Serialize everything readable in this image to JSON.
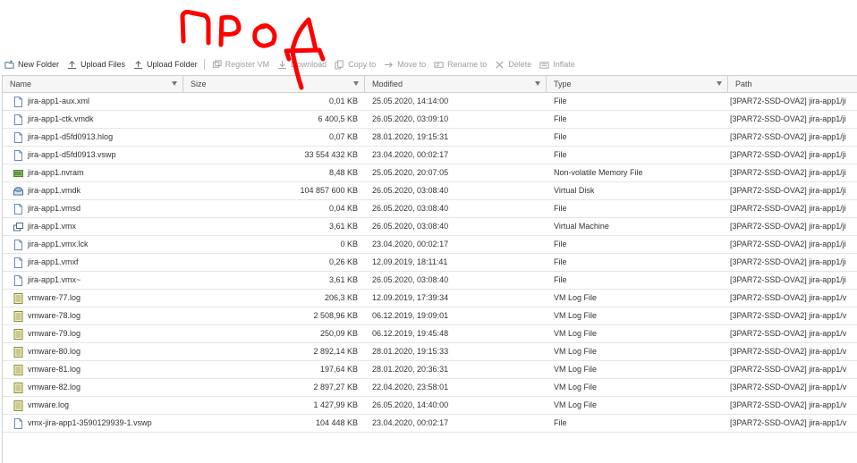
{
  "annotation_text": "ПРОД",
  "toolbar": [
    {
      "label": "New Folder",
      "icon": "new-folder-icon",
      "enabled": true
    },
    {
      "label": "Upload Files",
      "icon": "upload-icon",
      "enabled": true
    },
    {
      "label": "Upload Folder",
      "icon": "upload-icon",
      "enabled": true
    },
    {
      "label": "Register VM",
      "icon": "register-vm-icon",
      "enabled": false
    },
    {
      "label": "Download",
      "icon": "download-icon",
      "enabled": false
    },
    {
      "label": "Copy to",
      "icon": "copy-icon",
      "enabled": false
    },
    {
      "label": "Move to",
      "icon": "move-icon",
      "enabled": false
    },
    {
      "label": "Rename to",
      "icon": "rename-icon",
      "enabled": false
    },
    {
      "label": "Delete",
      "icon": "delete-icon",
      "enabled": false
    },
    {
      "label": "Inflate",
      "icon": "inflate-icon",
      "enabled": false
    }
  ],
  "columns": [
    "Name",
    "Size",
    "Modified",
    "Type",
    "Path"
  ],
  "rows": [
    {
      "name": "jira-app1-aux.xml",
      "size": "0,01 KB",
      "modified": "25.05.2020, 14:14:00",
      "type": "File",
      "path": "[3PAR72-SSD-OVA2] jira-app1/ji",
      "icon": "file-icon"
    },
    {
      "name": "jira-app1-ctk.vmdk",
      "size": "6 400,5 KB",
      "modified": "26.05.2020, 03:09:10",
      "type": "File",
      "path": "[3PAR72-SSD-OVA2] jira-app1/ji",
      "icon": "file-icon"
    },
    {
      "name": "jira-app1-d5fd0913.hlog",
      "size": "0,07 KB",
      "modified": "28.01.2020, 19:15:31",
      "type": "File",
      "path": "[3PAR72-SSD-OVA2] jira-app1/ji",
      "icon": "file-icon"
    },
    {
      "name": "jira-app1-d5fd0913.vswp",
      "size": "33 554 432 KB",
      "modified": "23.04.2020, 00:02:17",
      "type": "File",
      "path": "[3PAR72-SSD-OVA2] jira-app1/ji",
      "icon": "file-icon"
    },
    {
      "name": "jira-app1.nvram",
      "size": "8,48 KB",
      "modified": "25.05.2020, 20:07:05",
      "type": "Non-volatile Memory File",
      "path": "[3PAR72-SSD-OVA2] jira-app1/ji",
      "icon": "nvram-icon"
    },
    {
      "name": "jira-app1.vmdk",
      "size": "104 857 600 KB",
      "modified": "26.05.2020, 03:08:40",
      "type": "Virtual Disk",
      "path": "[3PAR72-SSD-OVA2] jira-app1/ji",
      "icon": "virtual-disk-icon"
    },
    {
      "name": "jira-app1.vmsd",
      "size": "0,04 KB",
      "modified": "26.05.2020, 03:08:40",
      "type": "File",
      "path": "[3PAR72-SSD-OVA2] jira-app1/ji",
      "icon": "file-icon"
    },
    {
      "name": "jira-app1.vmx",
      "size": "3,61 KB",
      "modified": "26.05.2020, 03:08:40",
      "type": "Virtual Machine",
      "path": "[3PAR72-SSD-OVA2] jira-app1/ji",
      "icon": "virtual-machine-icon"
    },
    {
      "name": "jira-app1.vmx.lck",
      "size": "0 KB",
      "modified": "23.04.2020, 00:02:17",
      "type": "File",
      "path": "[3PAR72-SSD-OVA2] jira-app1/ji",
      "icon": "file-icon"
    },
    {
      "name": "jira-app1.vmxf",
      "size": "0,26 KB",
      "modified": "12.09.2019, 18:11:41",
      "type": "File",
      "path": "[3PAR72-SSD-OVA2] jira-app1/ji",
      "icon": "file-icon"
    },
    {
      "name": "jira-app1.vmx~",
      "size": "3,61 KB",
      "modified": "26.05.2020, 03:08:40",
      "type": "File",
      "path": "[3PAR72-SSD-OVA2] jira-app1/ji",
      "icon": "file-icon"
    },
    {
      "name": "vmware-77.log",
      "size": "206,3 KB",
      "modified": "12.09.2019, 17:39:34",
      "type": "VM Log File",
      "path": "[3PAR72-SSD-OVA2] jira-app1/v",
      "icon": "log-file-icon"
    },
    {
      "name": "vmware-78.log",
      "size": "2 508,96 KB",
      "modified": "06.12.2019, 19:09:01",
      "type": "VM Log File",
      "path": "[3PAR72-SSD-OVA2] jira-app1/v",
      "icon": "log-file-icon"
    },
    {
      "name": "vmware-79.log",
      "size": "250,09 KB",
      "modified": "06.12.2019, 19:45:48",
      "type": "VM Log File",
      "path": "[3PAR72-SSD-OVA2] jira-app1/v",
      "icon": "log-file-icon"
    },
    {
      "name": "vmware-80.log",
      "size": "2 892,14 KB",
      "modified": "28.01.2020, 19:15:33",
      "type": "VM Log File",
      "path": "[3PAR72-SSD-OVA2] jira-app1/v",
      "icon": "log-file-icon"
    },
    {
      "name": "vmware-81.log",
      "size": "197,64 KB",
      "modified": "28.01.2020, 20:36:31",
      "type": "VM Log File",
      "path": "[3PAR72-SSD-OVA2] jira-app1/v",
      "icon": "log-file-icon"
    },
    {
      "name": "vmware-82.log",
      "size": "2 897,27 KB",
      "modified": "22.04.2020, 23:58:01",
      "type": "VM Log File",
      "path": "[3PAR72-SSD-OVA2] jira-app1/v",
      "icon": "log-file-icon"
    },
    {
      "name": "vmware.log",
      "size": "1 427,99 KB",
      "modified": "26.05.2020, 14:40:00",
      "type": "VM Log File",
      "path": "[3PAR72-SSD-OVA2] jira-app1/v",
      "icon": "log-file-icon"
    },
    {
      "name": "vmx-jira-app1-3590129939-1.vswp",
      "size": "104 448 KB",
      "modified": "23.04.2020, 00:02:17",
      "type": "File",
      "path": "[3PAR72-SSD-OVA2] jira-app1/v",
      "icon": "file-icon"
    }
  ],
  "colors": {
    "annotation": "#ff0000",
    "header_bg": "#f6f6f6",
    "border": "#d0d0d0",
    "disabled_text": "#9aa0a6"
  }
}
